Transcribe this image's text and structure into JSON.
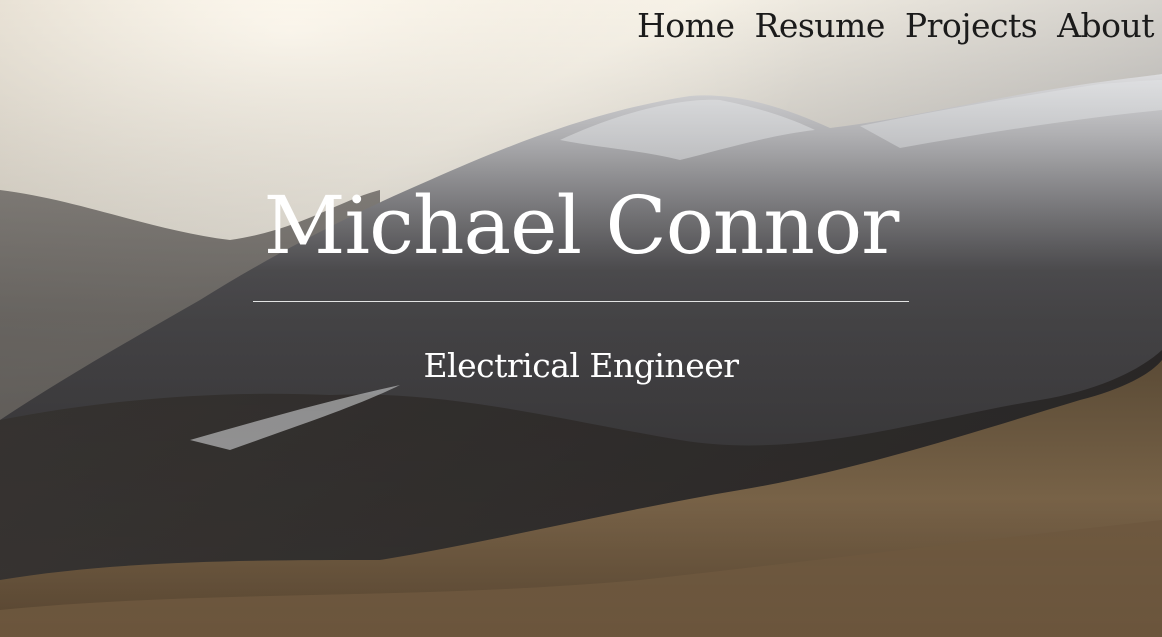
{
  "nav": {
    "items": [
      {
        "label": "Home"
      },
      {
        "label": "Resume"
      },
      {
        "label": "Projects"
      },
      {
        "label": "About"
      }
    ]
  },
  "hero": {
    "name": "Michael Connor",
    "tagline": "Electrical Engineer"
  },
  "colors": {
    "nav_text": "#1b1b1b",
    "hero_text": "#ffffff"
  }
}
